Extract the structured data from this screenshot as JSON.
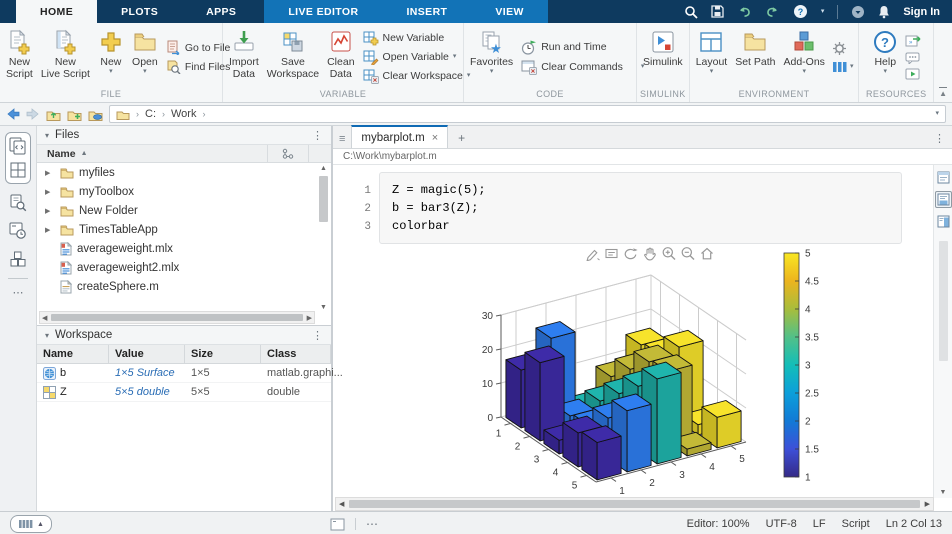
{
  "tabstrip": {
    "tabs": [
      {
        "label": "HOME"
      },
      {
        "label": "PLOTS"
      },
      {
        "label": "APPS"
      }
    ],
    "contextual": [
      {
        "label": "LIVE EDITOR"
      },
      {
        "label": "INSERT"
      },
      {
        "label": "VIEW"
      }
    ],
    "sign_in": "Sign In"
  },
  "ribbon": {
    "file": {
      "section": "FILE",
      "new_script": {
        "l1": "New",
        "l2": "Script"
      },
      "new_live_script": {
        "l1": "New",
        "l2": "Live Script"
      },
      "new": "New",
      "open": "Open",
      "go_to_file": "Go to File",
      "find_files": "Find Files"
    },
    "variable": {
      "section": "VARIABLE",
      "import_data": {
        "l1": "Import",
        "l2": "Data"
      },
      "save_workspace": {
        "l1": "Save",
        "l2": "Workspace"
      },
      "clean_data": {
        "l1": "Clean",
        "l2": "Data"
      },
      "new_variable": "New Variable",
      "open_variable": "Open Variable",
      "clear_workspace": "Clear Workspace"
    },
    "code": {
      "section": "CODE",
      "favorites": "Favorites",
      "run_and_time": "Run and Time",
      "clear_commands": "Clear Commands"
    },
    "simulink": {
      "section": "SIMULINK",
      "simulink": "Simulink"
    },
    "environment": {
      "section": "ENVIRONMENT",
      "layout": "Layout",
      "set_path": "Set Path",
      "add_ons": "Add-Ons"
    },
    "resources": {
      "section": "RESOURCES",
      "help": "Help"
    }
  },
  "address": {
    "drive": "C:",
    "folder": "Work"
  },
  "files_panel": {
    "title": "Files",
    "column": "Name",
    "items": [
      {
        "name": "myfiles",
        "type": "folder"
      },
      {
        "name": "myToolbox",
        "type": "folder"
      },
      {
        "name": "New Folder",
        "type": "folder"
      },
      {
        "name": "TimesTableApp",
        "type": "folder"
      },
      {
        "name": "averageweight.mlx",
        "type": "mlx"
      },
      {
        "name": "averageweight2.mlx",
        "type": "mlx"
      },
      {
        "name": "createSphere.m",
        "type": "m"
      }
    ]
  },
  "workspace": {
    "title": "Workspace",
    "columns": [
      "Name",
      "Value",
      "Size",
      "Class"
    ],
    "rows": [
      {
        "name": "b",
        "value": "1×5 Surface",
        "size": "1×5",
        "class": "matlab.graphi...",
        "icon": "surface"
      },
      {
        "name": "Z",
        "value": "5×5 double",
        "size": "5×5",
        "class": "double",
        "icon": "matrix"
      }
    ]
  },
  "editor": {
    "tab": "mybarplot.m",
    "path": "C:\\Work\\mybarplot.m",
    "lines": [
      {
        "n": "1",
        "code": "Z = magic(5);"
      },
      {
        "n": "2",
        "code": "b = bar3(Z);"
      },
      {
        "n": "3",
        "code": "colorbar"
      }
    ]
  },
  "statusbar": {
    "items": [
      "Editor: 100%",
      "UTF-8",
      "LF",
      "Script",
      "Ln 2 Col 13"
    ]
  },
  "icons": {
    "caret": "▾",
    "menu": "⋮",
    "close": "×",
    "new_tab": "+",
    "hamburger": "≡",
    "tree_expand": "▶",
    "sort_asc": "▲",
    "collapse": "▾",
    "sep": "›",
    "ellipsis": "⋯",
    "scroll_up": "▲",
    "scroll_down": "▼",
    "scroll_left": "◀",
    "scroll_right": "▶",
    "collapse_ribbon": "▲"
  },
  "chart_data": {
    "type": "bar",
    "subtype": "bar3",
    "title": "",
    "matrix": [
      [
        17,
        24,
        1,
        8,
        15
      ],
      [
        23,
        5,
        7,
        14,
        16
      ],
      [
        4,
        6,
        13,
        20,
        22
      ],
      [
        10,
        12,
        19,
        21,
        3
      ],
      [
        11,
        18,
        25,
        2,
        9
      ]
    ],
    "x_ticks": [
      1,
      2,
      3,
      4,
      5
    ],
    "y_ticks": [
      1,
      2,
      3,
      4,
      5
    ],
    "z_ticks": [
      0,
      10,
      20,
      30
    ],
    "zlim": [
      0,
      30
    ],
    "grid": true,
    "series_colors": [
      "#3e2ba8",
      "#2e7ef0",
      "#1fb5ad",
      "#c3ba37",
      "#f7e32b"
    ],
    "colorbar": {
      "min": 1,
      "max": 5,
      "ticks": [
        5,
        4.5,
        4,
        3.5,
        3,
        2.5,
        2,
        1.5,
        1
      ],
      "gradient_bottom_to_top": [
        "#352a87",
        "#3d50d8",
        "#127ad6",
        "#0c9fda",
        "#13beb8",
        "#52c088",
        "#a8bd3c",
        "#ecb41e",
        "#f9e723"
      ]
    }
  }
}
